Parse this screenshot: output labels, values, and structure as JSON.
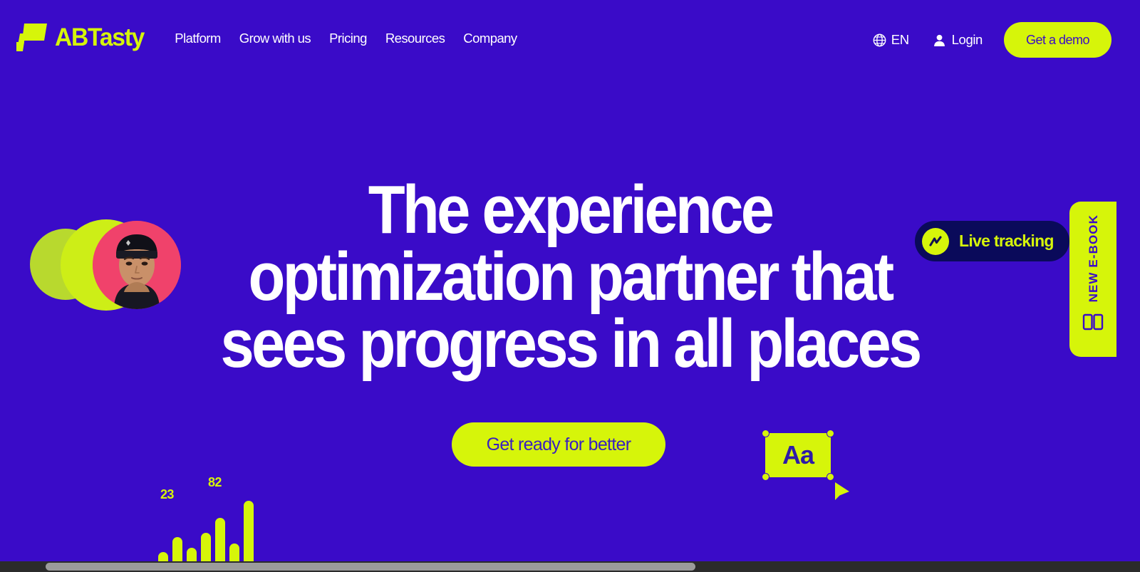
{
  "theme": {
    "background": "#3A0BC8",
    "accent_lime": "#D6F50A",
    "navy": "#0A0A5A",
    "white": "#FFFFFF",
    "avatar_pink": "#F0426B"
  },
  "header": {
    "brand_name": "ABTasty",
    "brand_mark_icon": "abtasty-flag-logo-icon",
    "nav": [
      {
        "label": "Platform"
      },
      {
        "label": "Grow with us"
      },
      {
        "label": "Pricing"
      },
      {
        "label": "Resources"
      },
      {
        "label": "Company"
      }
    ],
    "language": {
      "icon": "globe-icon",
      "label": "EN"
    },
    "login": {
      "icon": "user-icon",
      "label": "Login"
    },
    "demo_button": {
      "label": "Get a demo"
    }
  },
  "hero": {
    "title_lines": [
      "The experience",
      "optimization partner that",
      "sees progress in all places"
    ],
    "cta_label": "Get ready for better"
  },
  "decorations": {
    "live_tracking": {
      "label": "Live tracking",
      "icon": "trending-line-icon"
    },
    "ebook_tab": {
      "label": "NEW E-BOOK",
      "icon": "book-icon"
    },
    "text_box": {
      "label": "Aa",
      "handles": [
        "top-left",
        "top-right",
        "bottom-left",
        "bottom-right"
      ],
      "cursor_icon": "cursor-arrow-icon"
    },
    "avatar_cluster": {
      "circle_colors": [
        "#B8D92E",
        "#CDEE17"
      ],
      "photo_background": "#F0426B"
    }
  },
  "chart_data": {
    "type": "bar",
    "title": "",
    "categories": [
      "1",
      "2",
      "3",
      "4",
      "5",
      "6",
      "7"
    ],
    "values": [
      23,
      40,
      28,
      45,
      62,
      33,
      82
    ],
    "labels": [
      {
        "text": "23",
        "index": 0
      },
      {
        "text": "82",
        "index": 6
      }
    ],
    "xlabel": "",
    "ylabel": "",
    "ylim": [
      0,
      90
    ],
    "grid": false,
    "legend": false,
    "bar_color": "#D6F50A"
  },
  "scrollbar": {
    "orientation": "horizontal",
    "thumb_position_pct": 4,
    "thumb_width_pct": 57
  }
}
